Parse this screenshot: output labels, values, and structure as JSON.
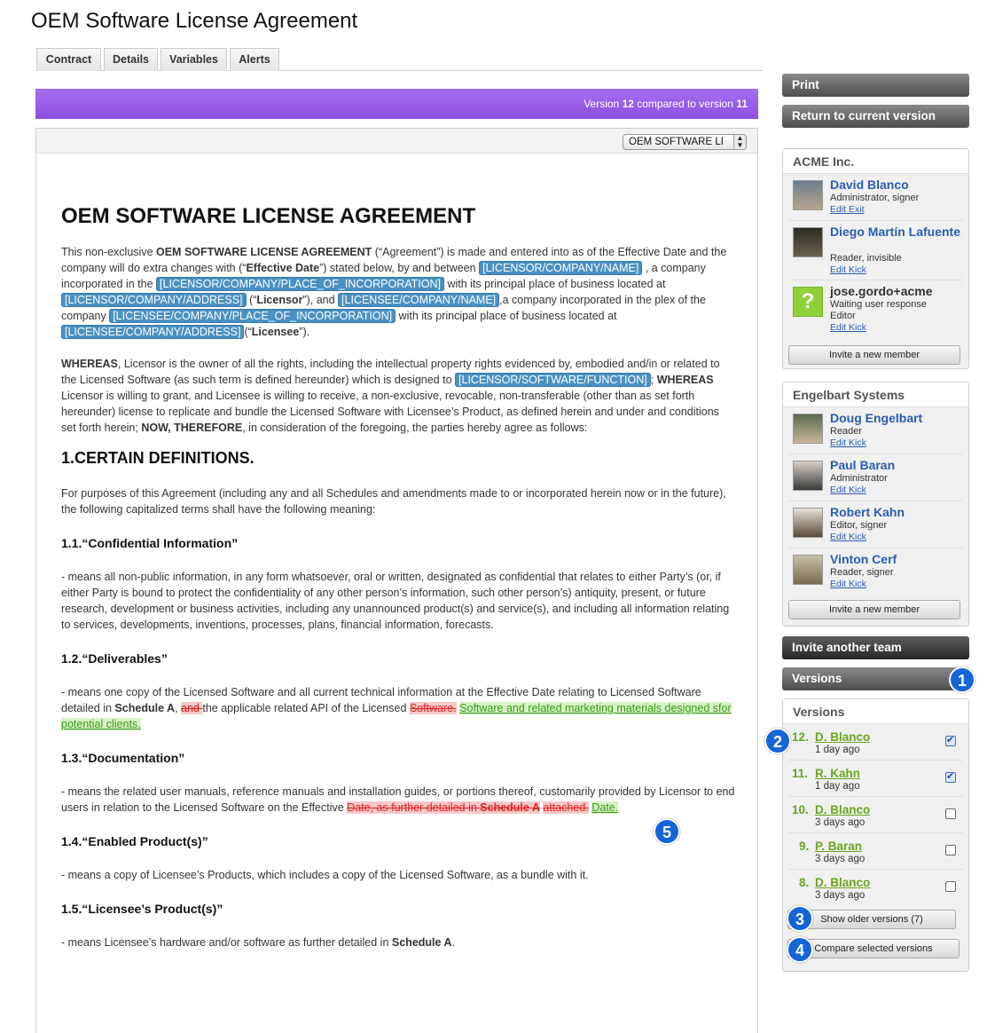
{
  "page": {
    "title": "OEM Software License Agreement"
  },
  "tabs": [
    "Contract",
    "Details",
    "Variables",
    "Alerts"
  ],
  "version_bar": {
    "prefix": "Version ",
    "current": "12",
    "middle": " compared to version ",
    "previous": "11"
  },
  "doc_select": {
    "value": "OEM SOFTWARE LI"
  },
  "document": {
    "heading": "OEM SOFTWARE LICENSE AGREEMENT",
    "p1": {
      "t1": "This non-exclusive ",
      "b1": "OEM SOFTWARE LICENSE AGREEMENT",
      "t2": " (“Agreement”) is made and entered into as of the Effective Date and the company will do extra changes with (“",
      "b2": "Effective Date",
      "t3": "”) stated below, by and between ",
      "v1": "[LICENSOR/COMPANY/NAME]",
      "t4": " , a company incorporated in the ",
      "v2": "[LICENSOR/COMPANY/PLACE_OF_INCORPORATION]",
      "t5": " with its principal place of business located at ",
      "v3": "[LICENSOR/COMPANY/ADDRESS]",
      "t6": " (“",
      "b3": "Licensor",
      "t7": "”), and ",
      "v4": "[LICENSEE/COMPANY/NAME]",
      "t8": ",a company incorporated in the plex of the company ",
      "v5": "[LICENSEE/COMPANY/PLACE_OF_INCORPORATION]",
      "t9": " with its principal place of business located at ",
      "v6": "[LICENSEE/COMPANY/ADDRESS]",
      "t10": "(“",
      "b4": "Licensee",
      "t11": "”)."
    },
    "p2": {
      "b1": "WHEREAS",
      "t1": ", Licensor is the owner of all the rights, including the intellectual property rights evidenced by, embodied and/in or related to the Licensed Software (as such term is defined hereunder) which is designed to ",
      "v1": "[LICENSOR/SOFTWARE/FUNCTION]",
      "t2": "; ",
      "b2": "WHEREAS",
      "t3": " Licensor is willing to grant, and Licensee is willing to receive, a non-exclusive, revocable, non-transferable (other than as set forth hereunder) license to replicate and bundle the Licensed Software with Licensee’s Product, as defined herein and under and conditions set forth herein; ",
      "b3": "NOW, THEREFORE",
      "t4": ", in consideration of the foregoing, the parties hereby agree as follows:"
    },
    "section1": "1.CERTAIN DEFINITIONS.",
    "p3": "For purposes of this Agreement (including any and all Schedules and amendments made to or incorporated herein now or in the future), the following capitalized terms shall have the following meaning:",
    "s11": "1.1.“Confidential Information”",
    "p4": "- means all non-public information, in any form whatsoever, oral or written, designated as confidential that relates to either Party’s (or, if either Party is bound to protect the confidentiality of any other person’s information, such other person’s) antiquity, present, or future research, development or business activities, including any unannounced product(s) and service(s), and including all information relating to services, developments, inventions, processes, plans, financial information, forecasts.",
    "s12": "1.2.“Deliverables”",
    "p5": {
      "t1": "- means one copy of the Licensed Software and all current technical information at the Effective Date relating to Licensed Software detailed in ",
      "b1": "Schedule A",
      "t2": ", ",
      "d1": " and ",
      "t3": " the applicable related API of the Licensed ",
      "d2": "Software.",
      "t4": " ",
      "i1": "Software and related marketing materials designed sfor potential clients."
    },
    "s13": "1.3.“Documentation”",
    "p6": {
      "t1": "- means the related user manuals, reference manuals and installation guides, or portions thereof, customarily provided by Licensor to end users in relation to the Licensed Software on the Effective ",
      "d1": " Date, as further detailed in ",
      "t2": " ",
      "d2": "Schedule A",
      "t3": " ",
      "d3": " attached.",
      "t4": " ",
      "i1": "Date."
    },
    "s14": "1.4.“Enabled Product(s)”",
    "p7": "- means a copy of Licensee’s Products, which includes a copy of the Licensed Software, as a bundle with it.",
    "s15": "1.5.“Licensee’s Product(s)”",
    "p8": {
      "t1": "- means Licensee’s hardware and/or software as further detailed in ",
      "b1": "Schedule A",
      "t2": "."
    }
  },
  "sidebar": {
    "print": "Print",
    "return": "Return to current version",
    "team1": {
      "name": "ACME Inc.",
      "members": [
        {
          "name": "David Blanco",
          "role": "Administrator, signer",
          "l1": "Edit",
          "l2": "Exit"
        },
        {
          "name": "Diego Martín Lafuente",
          "role": "Reader, invisible",
          "l1": "Edit",
          "l2": "Kick"
        },
        {
          "name": "jose.gordo+acme",
          "role": "Waiting user response",
          "role2": "Editor",
          "l1": "Edit",
          "l2": "Kick"
        }
      ],
      "invite": "Invite a new member"
    },
    "team2": {
      "name": "Engelbart Systems",
      "members": [
        {
          "name": "Doug Engelbart",
          "role": "Reader",
          "l1": "Edit",
          "l2": "Kick"
        },
        {
          "name": "Paul Baran",
          "role": "Administrator",
          "l1": "Edit",
          "l2": "Kick"
        },
        {
          "name": "Robert Kahn",
          "role": "Editor, signer",
          "l1": "Edit",
          "l2": "Kick"
        },
        {
          "name": "Vinton Cerf",
          "role": "Reader, signer",
          "l1": "Edit",
          "l2": "Kick"
        }
      ],
      "invite": "Invite a new member"
    },
    "invite_team": "Invite another team",
    "versions_btn": "Versions",
    "versions": {
      "title": "Versions",
      "items": [
        {
          "num": "12.",
          "name": "D. Blanco",
          "ago": "1 day ago",
          "checked": true
        },
        {
          "num": "11.",
          "name": "R. Kahn",
          "ago": "1 day ago",
          "checked": true
        },
        {
          "num": "10.",
          "name": "D. Blanco",
          "ago": "3 days ago",
          "checked": false
        },
        {
          "num": "9.",
          "name": "P. Baran",
          "ago": "3 days ago",
          "checked": false
        },
        {
          "num": "8.",
          "name": "D. Blanco",
          "ago": "3 days ago",
          "checked": false
        }
      ],
      "older": "Show older versions (7)",
      "compare": "Compare selected versions"
    }
  },
  "badges": [
    "1",
    "2",
    "3",
    "4",
    "5"
  ]
}
